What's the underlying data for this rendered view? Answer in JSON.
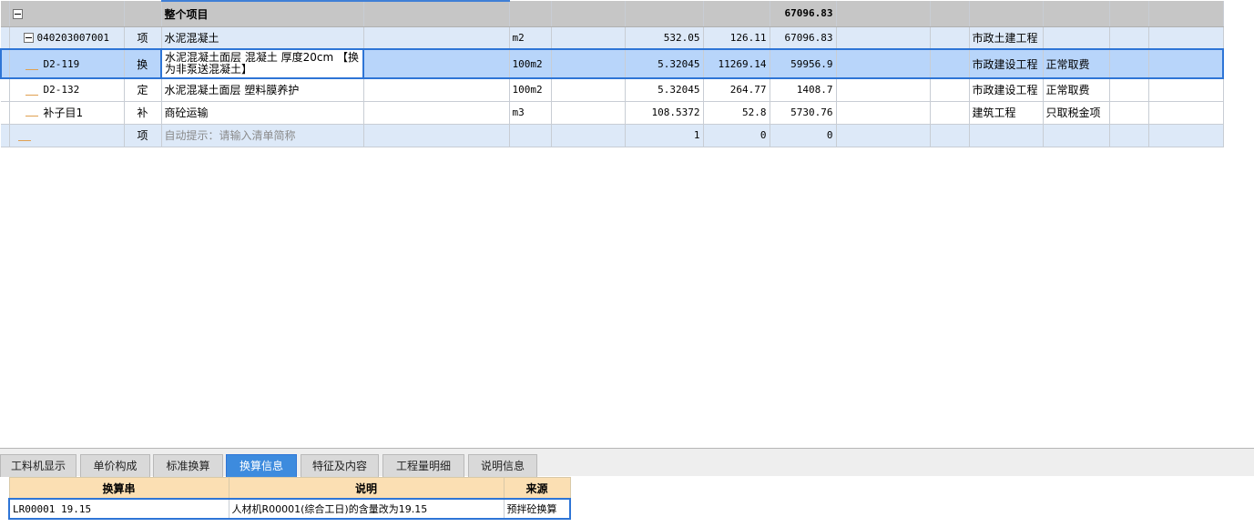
{
  "grid": {
    "header": {
      "name": "整个项目",
      "total": "67096.83"
    },
    "rows": [
      {
        "code": "040203007001",
        "type": "项",
        "name": "水泥混凝土",
        "unit": "m2",
        "qty": "532.05",
        "price": "126.11",
        "total": "67096.83",
        "specialty": "市政土建工程",
        "fee": ""
      },
      {
        "code": "D2-119",
        "type": "换",
        "name": "水泥混凝土面层 混凝土 厚度20cm 【换为非泵送混凝土】",
        "unit": "100m2",
        "qty": "5.32045",
        "price": "11269.14",
        "total": "59956.9",
        "specialty": "市政建设工程",
        "fee": "正常取费"
      },
      {
        "code": "D2-132",
        "type": "定",
        "name": "水泥混凝土面层 塑料膜养护",
        "unit": "100m2",
        "qty": "5.32045",
        "price": "264.77",
        "total": "1408.7",
        "specialty": "市政建设工程",
        "fee": "正常取费"
      },
      {
        "code": "补子目1",
        "type": "补",
        "name": "商砼运输",
        "unit": "m3",
        "qty": "108.5372",
        "price": "52.8",
        "total": "5730.76",
        "specialty": "建筑工程",
        "fee": "只取税金项"
      },
      {
        "code": "",
        "type": "项",
        "name": "自动提示：请输入清单简称",
        "unit": "",
        "qty": "1",
        "price": "0",
        "total": "0",
        "specialty": "",
        "fee": ""
      }
    ]
  },
  "tabs": [
    {
      "label": "工料机显示"
    },
    {
      "label": "单价构成"
    },
    {
      "label": "标准换算"
    },
    {
      "label": "换算信息"
    },
    {
      "label": "特征及内容"
    },
    {
      "label": "工程量明细"
    },
    {
      "label": "说明信息"
    }
  ],
  "sub_table": {
    "headers": {
      "col1": "换算串",
      "col2": "说明",
      "col3": "来源"
    },
    "row": {
      "col1": "LR00001 19.15",
      "col2": "人材机R00001(综合工日)的含量改为19.15",
      "col3": "预拌砼换算"
    }
  },
  "colors": {
    "active_tab": "#3d8bde",
    "selected_row": "#b8d5fa",
    "header_row": "#c6c6c6",
    "sub_header": "#fbdfb3"
  },
  "icons": {
    "collapse": "collapse-toggle-icon"
  }
}
